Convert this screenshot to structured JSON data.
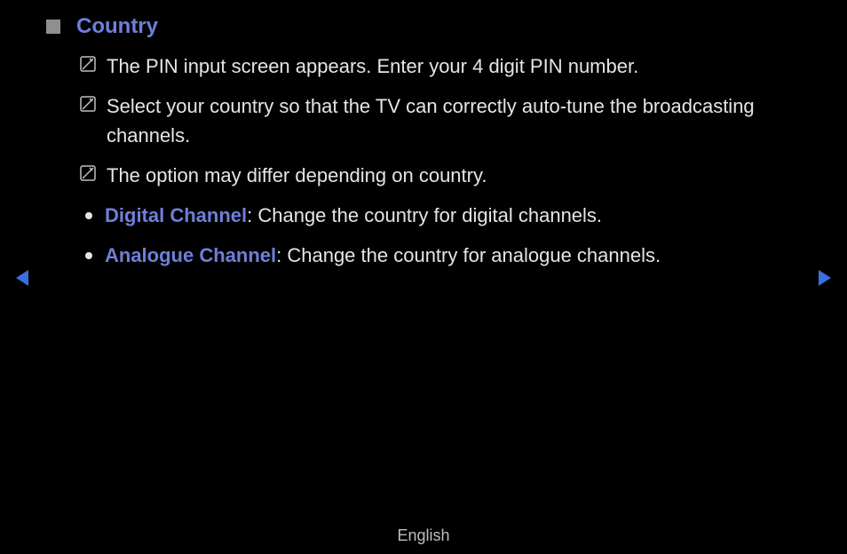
{
  "title": "Country",
  "notes": [
    "The PIN input screen appears. Enter your 4 digit PIN number.",
    "Select your country so that the TV can correctly auto-tune the broadcasting channels.",
    "The option may differ depending on country."
  ],
  "bullets": [
    {
      "label": "Digital Channel",
      "desc": ": Change the country for digital channels."
    },
    {
      "label": "Analogue Channel",
      "desc": ": Change the country for analogue channels."
    }
  ],
  "footer": "English"
}
